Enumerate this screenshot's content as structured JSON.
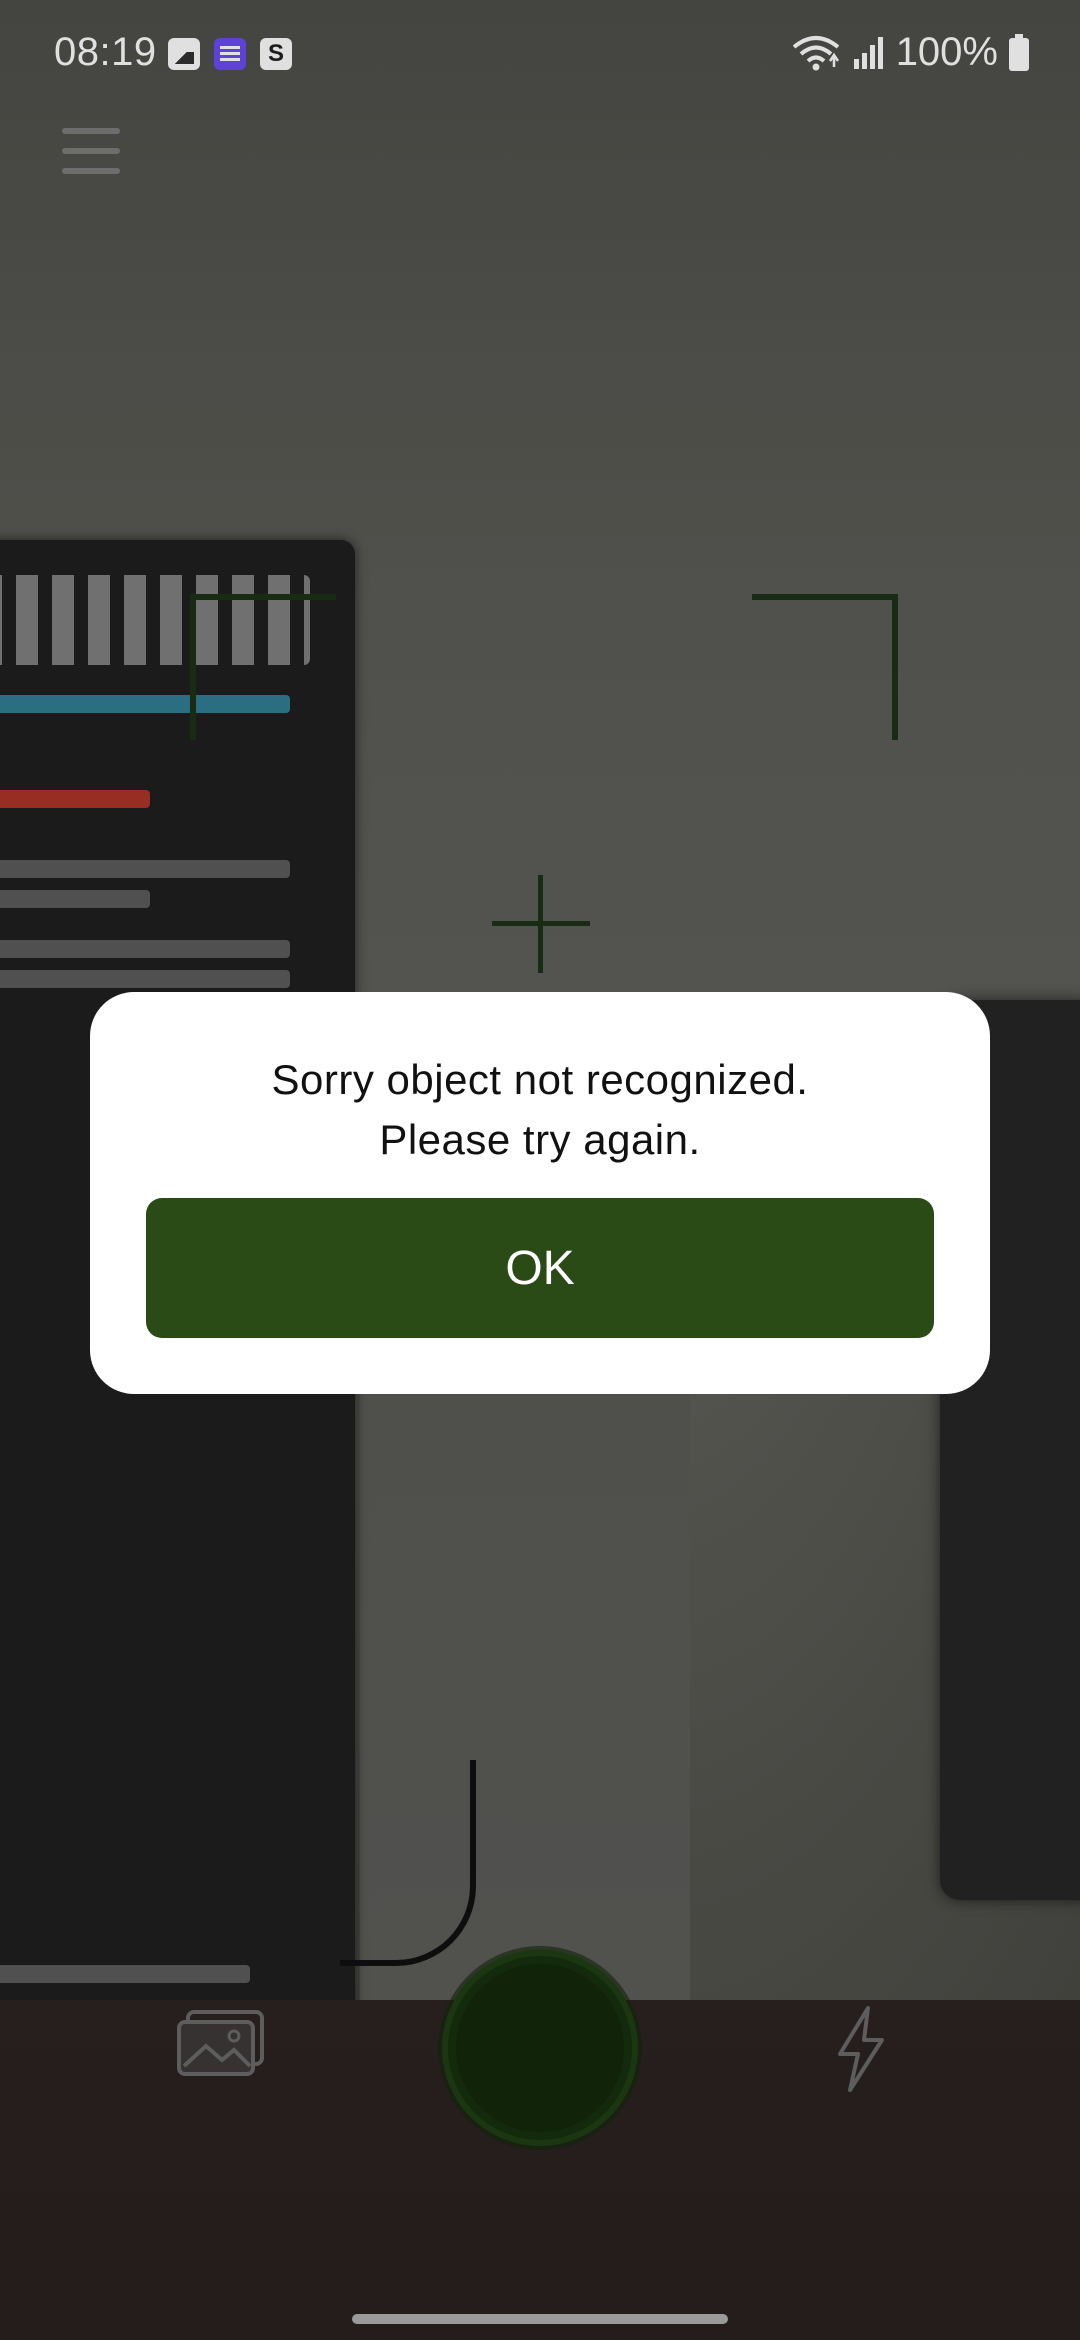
{
  "status_bar": {
    "time": "08:19",
    "battery": "100%",
    "notification_icons": [
      "gallery-icon",
      "list-app-icon",
      "s-app-icon"
    ],
    "s_app_glyph": "S"
  },
  "dialog": {
    "message_line1": "Sorry object not recognized.",
    "message_line2": "Please try again.",
    "ok_label": "OK"
  },
  "colors": {
    "accent": "#2a4a16",
    "viewfinder": "#1c3316"
  }
}
